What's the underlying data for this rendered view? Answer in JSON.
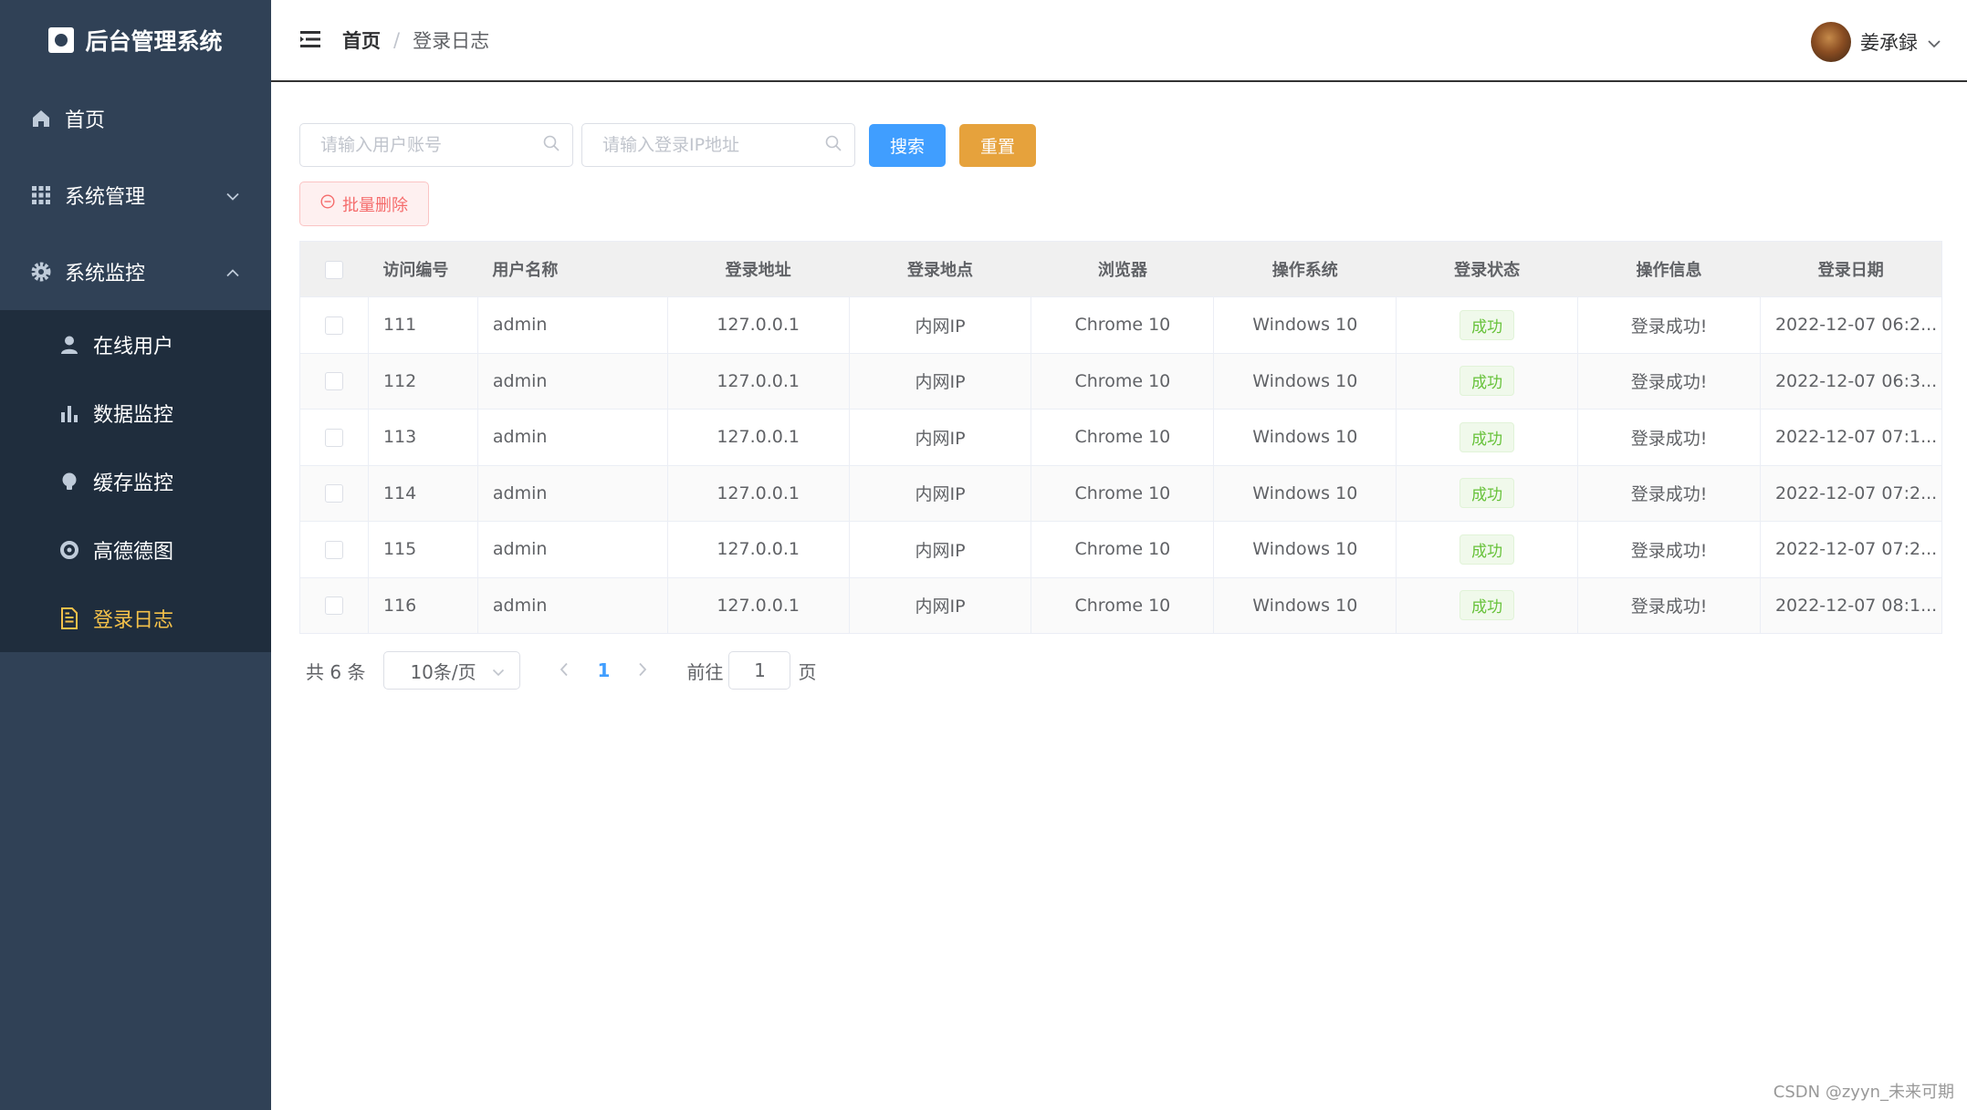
{
  "app": {
    "title": "后台管理系统"
  },
  "sidebar": {
    "items": [
      {
        "label": "首页",
        "icon": "home-icon"
      },
      {
        "label": "系统管理",
        "icon": "grid-icon",
        "expanded": false
      },
      {
        "label": "系统监控",
        "icon": "gear-icon",
        "expanded": true
      },
      {
        "label": "在线用户",
        "icon": "user-icon"
      },
      {
        "label": "数据监控",
        "icon": "bar-chart-icon"
      },
      {
        "label": "缓存监控",
        "icon": "lightbulb-icon"
      },
      {
        "label": "高德德图",
        "icon": "map-icon"
      },
      {
        "label": "登录日志",
        "icon": "document-icon",
        "active": true
      }
    ]
  },
  "header": {
    "breadcrumb_home": "首页",
    "breadcrumb_sep": "/",
    "breadcrumb_current": "登录日志",
    "user_name": "姜承録"
  },
  "search": {
    "account_placeholder": "请输入用户账号",
    "ip_placeholder": "请输入登录IP地址",
    "search_label": "搜索",
    "reset_label": "重置",
    "batch_delete_label": "批量删除"
  },
  "table": {
    "columns": [
      "访问编号",
      "用户名称",
      "登录地址",
      "登录地点",
      "浏览器",
      "操作系统",
      "登录状态",
      "操作信息",
      "登录日期"
    ],
    "rows": [
      {
        "id": "111",
        "user": "admin",
        "ip": "127.0.0.1",
        "location": "内网IP",
        "browser": "Chrome 10",
        "os": "Windows 10",
        "status": "成功",
        "msg": "登录成功!",
        "date": "2022-12-07 06:2..."
      },
      {
        "id": "112",
        "user": "admin",
        "ip": "127.0.0.1",
        "location": "内网IP",
        "browser": "Chrome 10",
        "os": "Windows 10",
        "status": "成功",
        "msg": "登录成功!",
        "date": "2022-12-07 06:3..."
      },
      {
        "id": "113",
        "user": "admin",
        "ip": "127.0.0.1",
        "location": "内网IP",
        "browser": "Chrome 10",
        "os": "Windows 10",
        "status": "成功",
        "msg": "登录成功!",
        "date": "2022-12-07 07:1..."
      },
      {
        "id": "114",
        "user": "admin",
        "ip": "127.0.0.1",
        "location": "内网IP",
        "browser": "Chrome 10",
        "os": "Windows 10",
        "status": "成功",
        "msg": "登录成功!",
        "date": "2022-12-07 07:2..."
      },
      {
        "id": "115",
        "user": "admin",
        "ip": "127.0.0.1",
        "location": "内网IP",
        "browser": "Chrome 10",
        "os": "Windows 10",
        "status": "成功",
        "msg": "登录成功!",
        "date": "2022-12-07 07:2..."
      },
      {
        "id": "116",
        "user": "admin",
        "ip": "127.0.0.1",
        "location": "内网IP",
        "browser": "Chrome 10",
        "os": "Windows 10",
        "status": "成功",
        "msg": "登录成功!",
        "date": "2022-12-07 08:1..."
      }
    ]
  },
  "pagination": {
    "total": "共 6 条",
    "page_size": "10条/页",
    "current_page": "1",
    "goto_label": "前往",
    "goto_value": "1",
    "goto_suffix": "页"
  },
  "watermark": "CSDN @zyyn_未来可期",
  "colors": {
    "sidebar_bg": "#304156",
    "active_menu": "#f4c14a",
    "primary": "#409eff",
    "warning": "#e6a23c",
    "danger": "#f56c6c",
    "success": "#67c23a"
  }
}
